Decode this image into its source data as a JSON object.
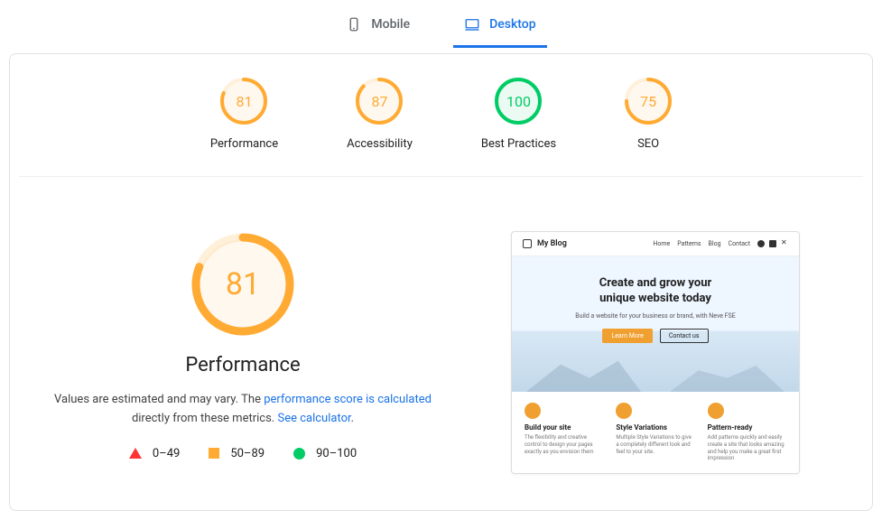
{
  "tabs": {
    "mobile": "Mobile",
    "desktop": "Desktop",
    "active": "desktop"
  },
  "colors": {
    "avg": "#fa3",
    "good": "#0c6",
    "bad": "#f33"
  },
  "scores": [
    {
      "label": "Performance",
      "value": 81,
      "color": "#fa3"
    },
    {
      "label": "Accessibility",
      "value": 87,
      "color": "#fa3"
    },
    {
      "label": "Best Practices",
      "value": 100,
      "color": "#0c6"
    },
    {
      "label": "SEO",
      "value": 75,
      "color": "#fa3"
    }
  ],
  "detail": {
    "score": 81,
    "color": "#fa3",
    "title": "Performance",
    "desc_prefix": "Values are estimated and may vary. The ",
    "link1": "performance score is calculated",
    "desc_mid": " directly from these metrics. ",
    "link2": "See calculator"
  },
  "legend": {
    "bad": "0–49",
    "avg": "50–89",
    "good": "90–100"
  },
  "preview": {
    "brand": "My Blog",
    "nav": [
      "Home",
      "Patterns",
      "Blog",
      "Contact"
    ],
    "hero_l1": "Create and grow your",
    "hero_l2": "unique website today",
    "hero_sub": "Build a website for your business or brand, with Neve FSE",
    "cta1": "Learn More",
    "cta2": "Contact us",
    "features": [
      {
        "title": "Build your site",
        "desc": "The flexibility and creative control to design your pages exactly as you envision them"
      },
      {
        "title": "Style Variations",
        "desc": "Multiple Style Variations to give a completely different look and feel to your site."
      },
      {
        "title": "Pattern-ready",
        "desc": "Add patterns quickly and easily create a site that looks amazing and help you make a great first impression"
      }
    ]
  }
}
